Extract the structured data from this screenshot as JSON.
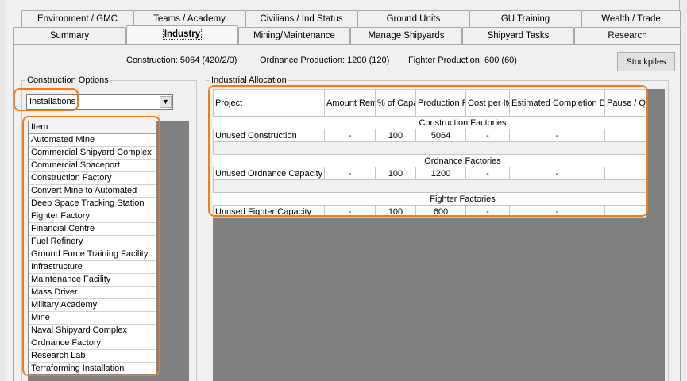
{
  "tabs_top": [
    {
      "label": "Environment / GMC"
    },
    {
      "label": "Teams / Academy"
    },
    {
      "label": "Civilians / Ind Status"
    },
    {
      "label": "Ground Units"
    },
    {
      "label": "GU Training"
    },
    {
      "label": "Wealth / Trade"
    }
  ],
  "tabs_bottom": [
    {
      "label": "Summary"
    },
    {
      "label": "Industry"
    },
    {
      "label": "Mining/Maintenance"
    },
    {
      "label": "Manage Shipyards"
    },
    {
      "label": "Shipyard Tasks"
    },
    {
      "label": "Research"
    }
  ],
  "summary": {
    "construction": "Construction: 5064  (420/2/0)",
    "ordnance": "Ordnance Production: 1200  (120)",
    "fighter": "Fighter Production: 600  (60)"
  },
  "buttons": {
    "stockpiles": "Stockpiles"
  },
  "construction_options": {
    "label": "Construction Options",
    "selected": "Installations",
    "list_header": "Item",
    "items": [
      "Automated Mine",
      "Commercial Shipyard Complex",
      "Commercial Spaceport",
      "Construction Factory",
      "Convert Mine to Automated",
      "Deep Space Tracking Station",
      "Fighter Factory",
      "Financial Centre",
      "Fuel Refinery",
      "Ground Force Training Facility",
      "Infrastructure",
      "Maintenance Facility",
      "Mass Driver",
      "Military Academy",
      "Mine",
      "Naval Shipyard Complex",
      "Ordnance Factory",
      "Research Lab",
      "Terraforming Installation"
    ]
  },
  "allocation": {
    "label": "Industrial Allocation",
    "columns": {
      "project": "Project",
      "amount": "Amount Remaining",
      "capacity": "% of Capacity",
      "rate": "Production Rate",
      "cost": "Cost per Item",
      "completion": "Estimated Completion Date",
      "pause": "Pause / Queue"
    },
    "sections": [
      {
        "title": "Construction Factories",
        "project": "Unused Construction",
        "amount": "-",
        "capacity": "100",
        "rate": "5064",
        "cost": "-",
        "completion": "-",
        "pause": ""
      },
      {
        "title": "Ordnance Factories",
        "project": "Unused Ordnance Capacity",
        "amount": "-",
        "capacity": "100",
        "rate": "1200",
        "cost": "-",
        "completion": "-",
        "pause": ""
      },
      {
        "title": "Fighter Factories",
        "project": "Unused Fighter Capacity",
        "amount": "-",
        "capacity": "100",
        "rate": "600",
        "cost": "-",
        "completion": "-",
        "pause": ""
      }
    ]
  },
  "colors": {
    "highlight": "#f07c1e",
    "grey_area": "#808080"
  }
}
